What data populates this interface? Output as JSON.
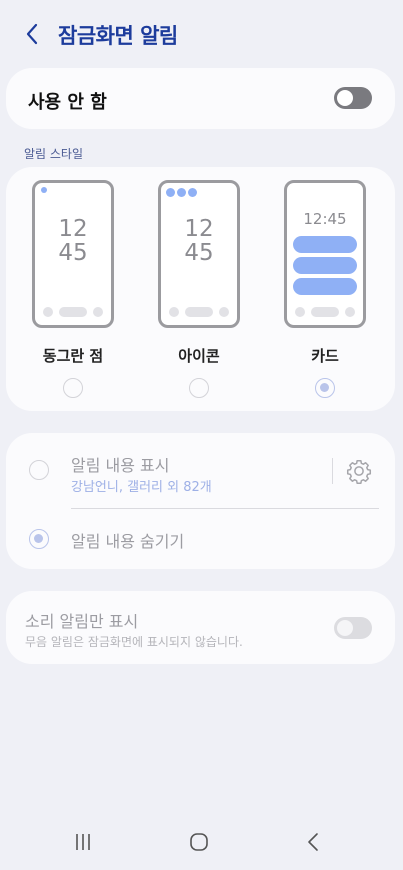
{
  "header": {
    "title": "잠금화면 알림"
  },
  "master": {
    "label": "사용 안 함",
    "enabled": false
  },
  "styles": {
    "section_label": "알림 스타일",
    "options": [
      {
        "label": "동그란 점",
        "selected": false,
        "clock": [
          "12",
          "45"
        ]
      },
      {
        "label": "아이콘",
        "selected": false,
        "clock": [
          "12",
          "45"
        ]
      },
      {
        "label": "카드",
        "selected": true,
        "clock": [
          "12:45"
        ]
      }
    ]
  },
  "content": {
    "show": {
      "title": "알림 내용 표시",
      "subtitle": "강남언니, 갤러리 외 82개",
      "selected": false
    },
    "hide": {
      "title": "알림 내용 숨기기",
      "selected": true
    }
  },
  "sound_only": {
    "title": "소리 알림만 표시",
    "subtitle": "무음 알림은 잠금화면에 표시되지 않습니다.",
    "enabled": false
  },
  "colors": {
    "title": "#1d3c9c",
    "accent_light": "#8fb0f5",
    "background": "#eff0f6",
    "card": "#fbfbfd"
  },
  "icons": [
    "back-arrow-icon",
    "gear-icon",
    "recent-apps-icon",
    "home-icon",
    "back-nav-icon"
  ]
}
